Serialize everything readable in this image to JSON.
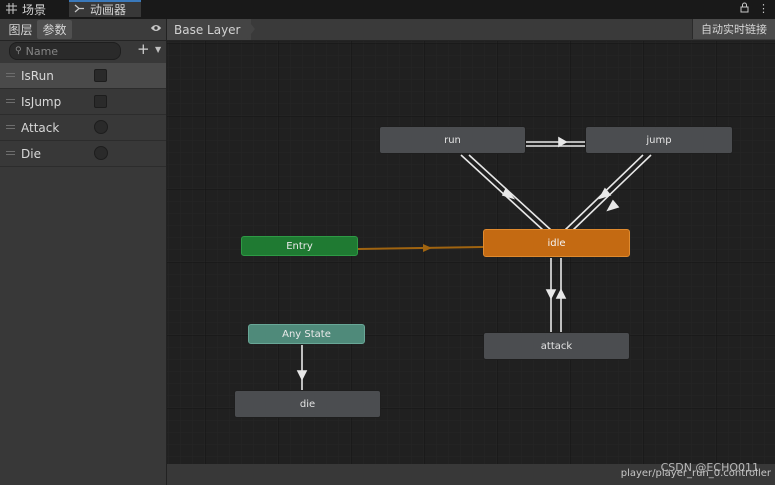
{
  "tabs": {
    "scene_label": "场景",
    "animator_label": "动画器"
  },
  "left_panel": {
    "tab_layers": "图层",
    "tab_parameters": "参数",
    "search_placeholder": "Name",
    "add_label": "+",
    "parameters": [
      {
        "name": "IsRun",
        "type": "bool"
      },
      {
        "name": "IsJump",
        "type": "bool"
      },
      {
        "name": "Attack",
        "type": "trigger"
      },
      {
        "name": "Die",
        "type": "trigger"
      }
    ]
  },
  "graph": {
    "breadcrumb": "Base Layer",
    "auto_live_link": "自动实时链接",
    "states": {
      "run": "run",
      "jump": "jump",
      "entry": "Entry",
      "idle": "idle",
      "any_state": "Any State",
      "attack": "attack",
      "die": "die"
    },
    "footer": "player/player_run_0.controller",
    "watermark": "CSDN @ECHO011"
  },
  "colors": {
    "accent_tab": "#3a79bb",
    "default_state": "#c46a12",
    "entry": "#1f7a32",
    "any_state": "#4f8a7a",
    "entry_edge": "#a06410"
  }
}
